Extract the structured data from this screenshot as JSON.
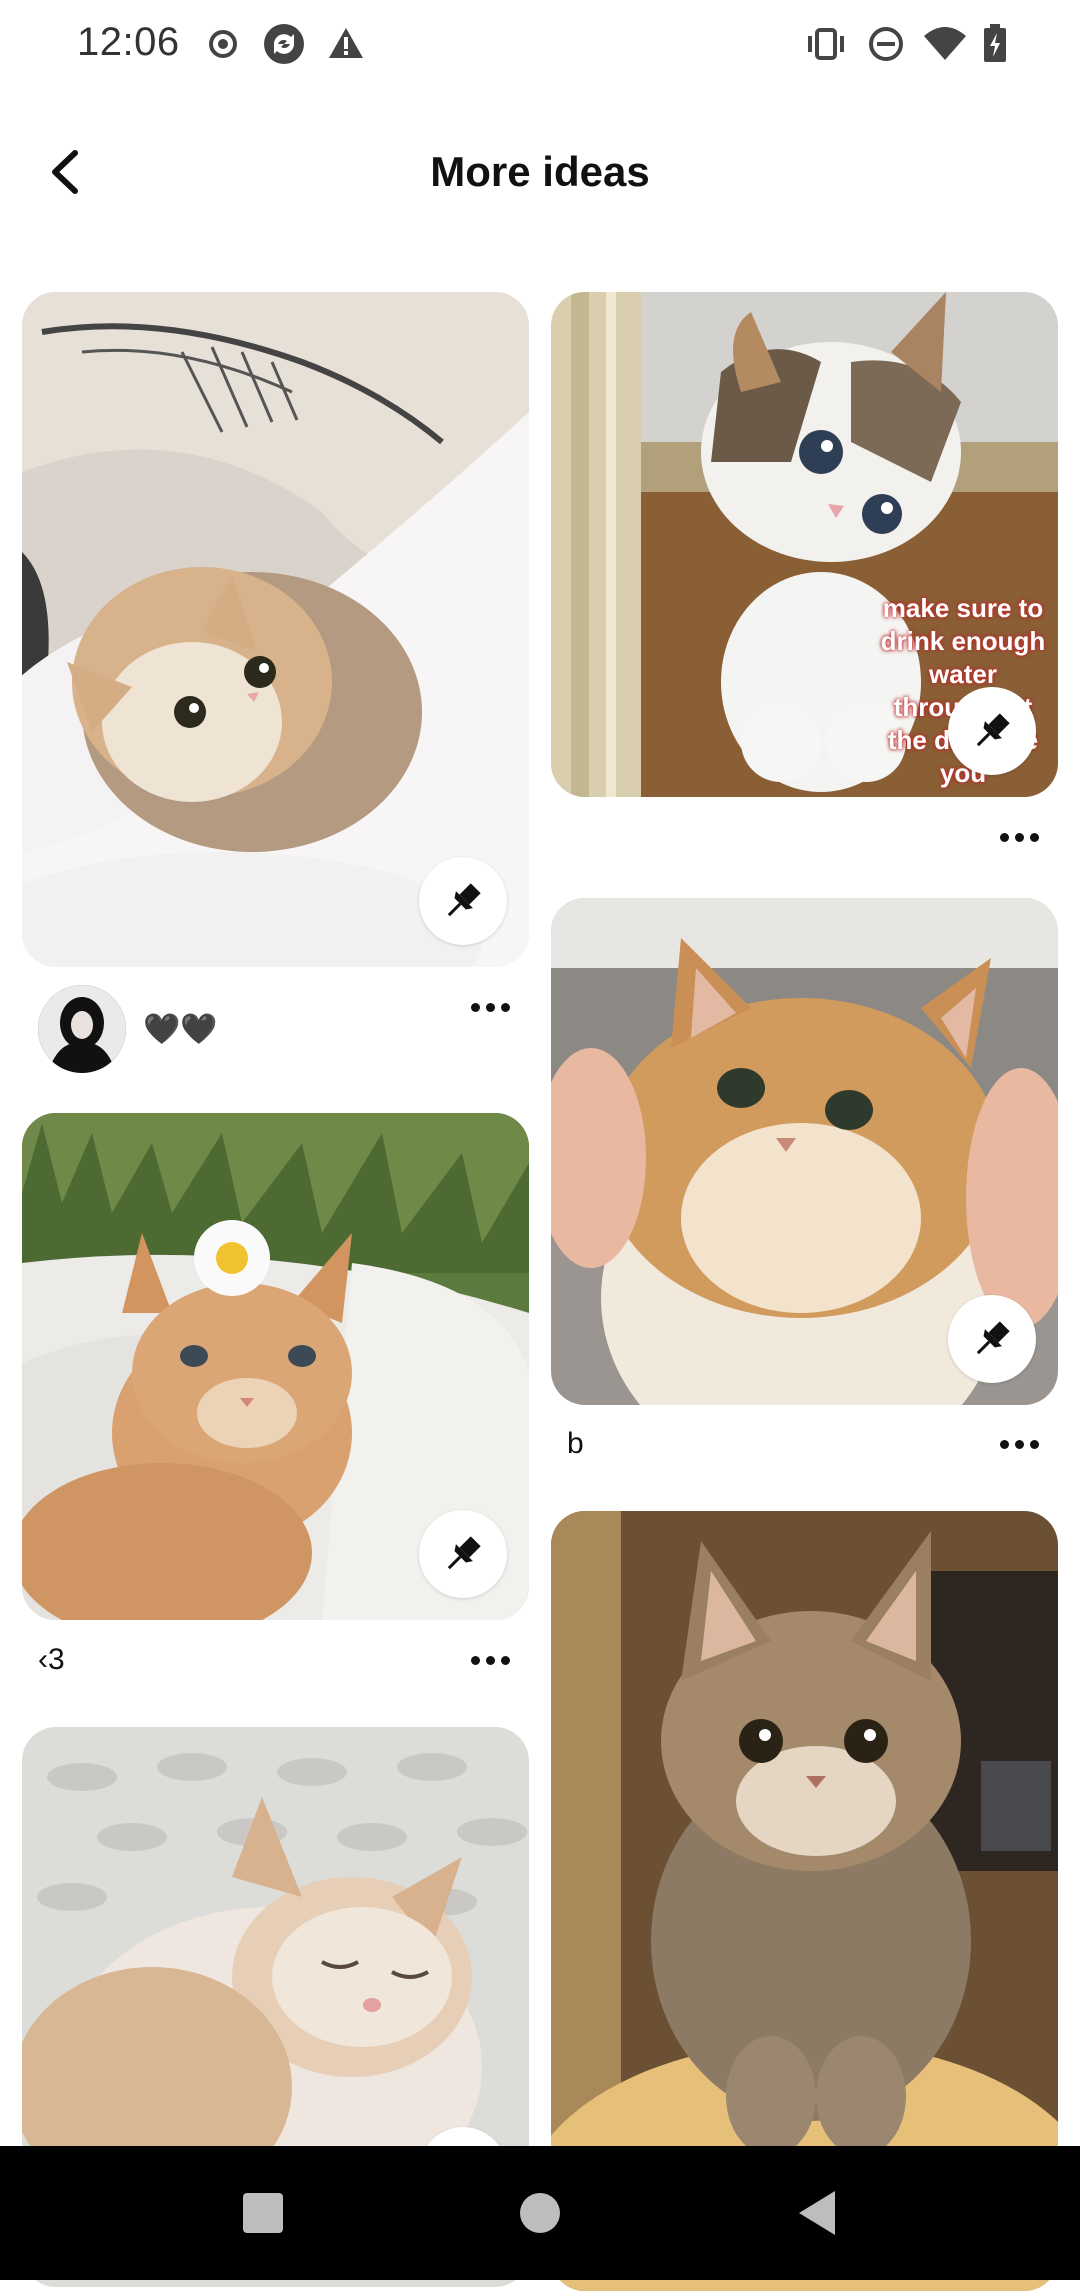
{
  "status_bar": {
    "time": "12:06"
  },
  "header": {
    "title": "More ideas"
  },
  "pins": {
    "pin1": {
      "author": "🖤🖤"
    },
    "pin2": {
      "overlay_lines": [
        "make sure to",
        "drink enough",
        "water",
        "throughout",
        "the day love",
        "you"
      ]
    },
    "pin3": {
      "label": "b"
    },
    "pin4": {
      "label": "‹3"
    }
  },
  "icons": {
    "status": [
      "record-icon",
      "sync-icon",
      "warning-icon",
      "vibrate-icon",
      "do-not-disturb-icon",
      "wifi-icon",
      "battery-icon"
    ],
    "save": "pushpin-icon",
    "more": "ellipsis-icon",
    "nav": [
      "recent-apps-icon",
      "home-icon",
      "back-icon"
    ]
  },
  "colors": {
    "background": "#ffffff",
    "navbar": "#000000",
    "text": "#111111"
  }
}
